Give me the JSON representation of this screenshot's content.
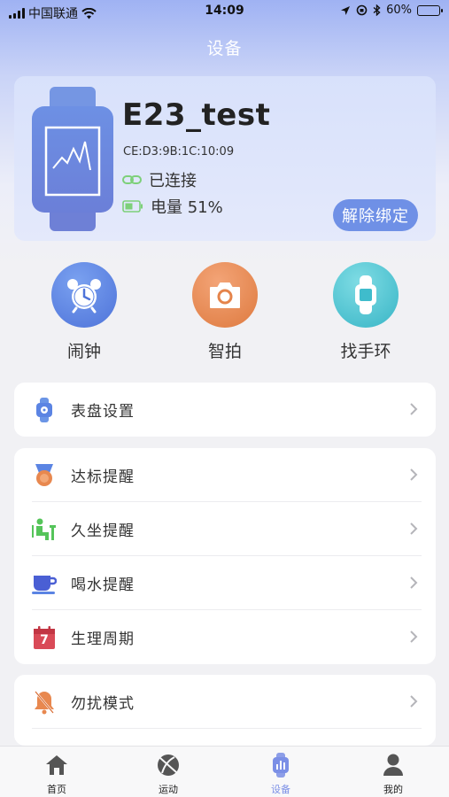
{
  "status_bar": {
    "carrier": "中国联通",
    "time": "14:09",
    "battery_percent": "60%",
    "battery_level": 0.6
  },
  "page": {
    "title": "设备"
  },
  "device": {
    "name": "E23_test",
    "mac": "CE:D3:9B:1C:10:09",
    "connection_status": "已连接",
    "battery_text": "电量 51%",
    "unbind_label": "解除绑定"
  },
  "quick_actions": [
    {
      "label": "闹钟",
      "icon": "alarm-clock-icon",
      "color": "#5b84e3"
    },
    {
      "label": "智拍",
      "icon": "camera-icon",
      "color": "#e8884f"
    },
    {
      "label": "找手环",
      "icon": "band-icon",
      "color": "#45c1cf"
    }
  ],
  "settings": {
    "dial": {
      "label": "表盘设置",
      "icon": "watch-face-icon"
    },
    "reminders": [
      {
        "label": "达标提醒",
        "icon": "medal-icon"
      },
      {
        "label": "久坐提醒",
        "icon": "sedentary-icon"
      },
      {
        "label": "喝水提醒",
        "icon": "cup-icon"
      },
      {
        "label": "生理周期",
        "icon": "calendar-icon",
        "badge": "7"
      }
    ],
    "dnd": {
      "label": "勿扰模式",
      "icon": "bell-off-icon"
    }
  },
  "tabs": [
    {
      "label": "首页",
      "icon": "home-icon"
    },
    {
      "label": "运动",
      "icon": "ball-icon"
    },
    {
      "label": "设备",
      "icon": "device-icon",
      "active": true
    },
    {
      "label": "我的",
      "icon": "profile-icon"
    }
  ],
  "colors": {
    "accent": "#6f90e6",
    "active_tab": "#7b8fe6"
  }
}
